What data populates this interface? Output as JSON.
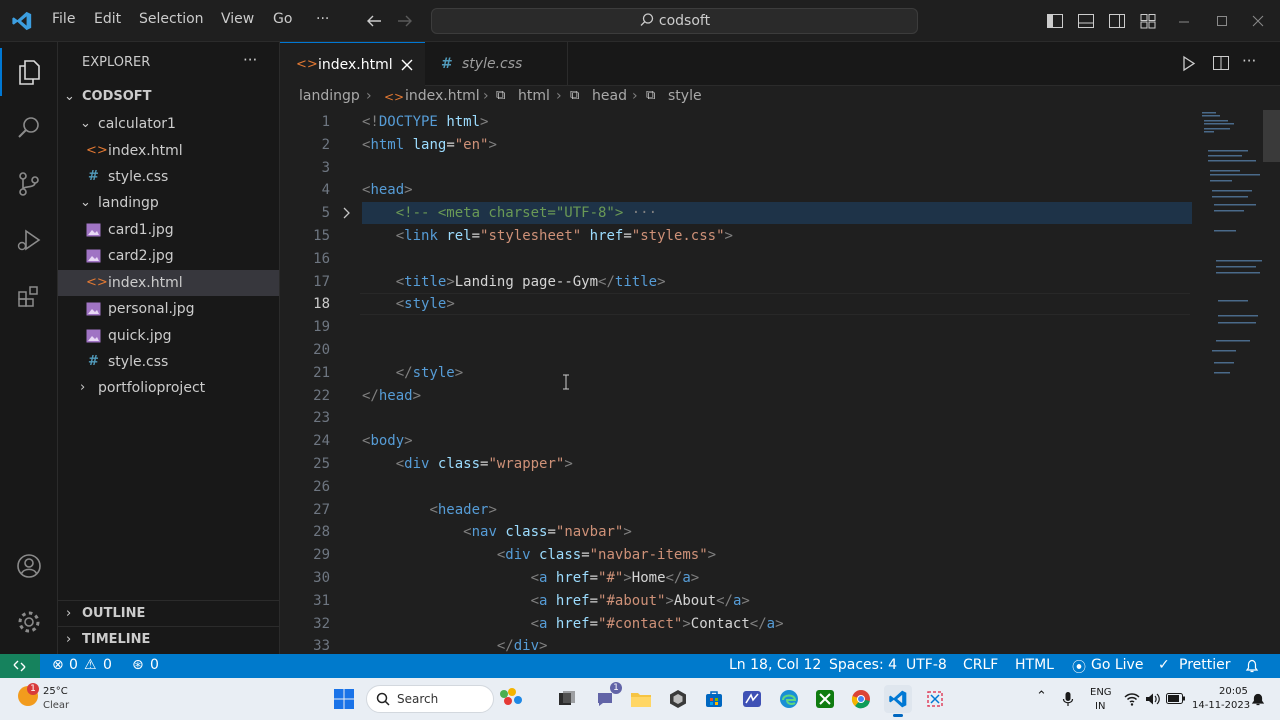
{
  "titlebar": {
    "menu": [
      "File",
      "Edit",
      "Selection",
      "View",
      "Go"
    ],
    "more": "···",
    "search": "codsoft"
  },
  "explorer": {
    "title": "EXPLORER",
    "more": "···",
    "root": "CODSOFT",
    "items": [
      {
        "label": "calculator1",
        "type": "folder",
        "open": true
      },
      {
        "label": "index.html",
        "type": "html"
      },
      {
        "label": "style.css",
        "type": "css"
      },
      {
        "label": "landingp",
        "type": "folder",
        "open": true
      },
      {
        "label": "card1.jpg",
        "type": "image"
      },
      {
        "label": "card2.jpg",
        "type": "image"
      },
      {
        "label": "index.html",
        "type": "html",
        "selected": true
      },
      {
        "label": "personal.jpg",
        "type": "image"
      },
      {
        "label": "quick.jpg",
        "type": "image"
      },
      {
        "label": "style.css",
        "type": "css"
      },
      {
        "label": "portfolioproject",
        "type": "folder",
        "open": false
      }
    ],
    "outline": "OUTLINE",
    "timeline": "TIMELINE"
  },
  "tabs": [
    {
      "label": "index.html",
      "active": true
    },
    {
      "label": "style.css",
      "active": false
    }
  ],
  "breadcrumb": [
    "landingp",
    "index.html",
    "html",
    "head",
    "style"
  ],
  "editor": {
    "current_line": 18,
    "lines": [
      {
        "n": "1",
        "code": [
          [
            "p",
            "<!"
          ],
          [
            "t",
            "DOCTYPE"
          ],
          [
            "x",
            " "
          ],
          [
            "a",
            "html"
          ],
          [
            "p",
            ">"
          ]
        ]
      },
      {
        "n": "2",
        "code": [
          [
            "p",
            "<"
          ],
          [
            "t",
            "html"
          ],
          [
            "x",
            " "
          ],
          [
            "a",
            "lang"
          ],
          [
            "x",
            "="
          ],
          [
            "s",
            "\"en\""
          ],
          [
            "p",
            ">"
          ]
        ]
      },
      {
        "n": "3",
        "code": []
      },
      {
        "n": "4",
        "code": [
          [
            "p",
            "<"
          ],
          [
            "t",
            "head"
          ],
          [
            "p",
            ">"
          ]
        ]
      },
      {
        "n": "5",
        "code": [
          [
            "x",
            "    "
          ],
          [
            "c",
            "<!-- <meta charset=\"UTF-8\">"
          ],
          [
            "p",
            " ···"
          ]
        ]
      },
      {
        "n": "15",
        "code": [
          [
            "x",
            "    "
          ],
          [
            "p",
            "<"
          ],
          [
            "t",
            "link"
          ],
          [
            "x",
            " "
          ],
          [
            "a",
            "rel"
          ],
          [
            "x",
            "="
          ],
          [
            "s",
            "\"stylesheet\""
          ],
          [
            "x",
            " "
          ],
          [
            "a",
            "href"
          ],
          [
            "x",
            "="
          ],
          [
            "s",
            "\"style.css\""
          ],
          [
            "p",
            ">"
          ]
        ]
      },
      {
        "n": "16",
        "code": []
      },
      {
        "n": "17",
        "code": [
          [
            "x",
            "    "
          ],
          [
            "p",
            "<"
          ],
          [
            "t",
            "title"
          ],
          [
            "p",
            ">"
          ],
          [
            "x",
            "Landing page--Gym"
          ],
          [
            "p",
            "</"
          ],
          [
            "t",
            "title"
          ],
          [
            "p",
            ">"
          ]
        ]
      },
      {
        "n": "18",
        "code": [
          [
            "x",
            "    "
          ],
          [
            "p",
            "<"
          ],
          [
            "t",
            "style"
          ],
          [
            "p",
            ">"
          ]
        ]
      },
      {
        "n": "19",
        "code": []
      },
      {
        "n": "20",
        "code": []
      },
      {
        "n": "21",
        "code": [
          [
            "x",
            "    "
          ],
          [
            "p",
            "</"
          ],
          [
            "t",
            "style"
          ],
          [
            "p",
            ">"
          ]
        ]
      },
      {
        "n": "22",
        "code": [
          [
            "p",
            "</"
          ],
          [
            "t",
            "head"
          ],
          [
            "p",
            ">"
          ]
        ]
      },
      {
        "n": "23",
        "code": []
      },
      {
        "n": "24",
        "code": [
          [
            "p",
            "<"
          ],
          [
            "t",
            "body"
          ],
          [
            "p",
            ">"
          ]
        ]
      },
      {
        "n": "25",
        "code": [
          [
            "x",
            "    "
          ],
          [
            "p",
            "<"
          ],
          [
            "t",
            "div"
          ],
          [
            "x",
            " "
          ],
          [
            "a",
            "class"
          ],
          [
            "x",
            "="
          ],
          [
            "s",
            "\"wrapper\""
          ],
          [
            "p",
            ">"
          ]
        ]
      },
      {
        "n": "26",
        "code": []
      },
      {
        "n": "27",
        "code": [
          [
            "x",
            "        "
          ],
          [
            "p",
            "<"
          ],
          [
            "t",
            "header"
          ],
          [
            "p",
            ">"
          ]
        ]
      },
      {
        "n": "28",
        "code": [
          [
            "x",
            "            "
          ],
          [
            "p",
            "<"
          ],
          [
            "t",
            "nav"
          ],
          [
            "x",
            " "
          ],
          [
            "a",
            "class"
          ],
          [
            "x",
            "="
          ],
          [
            "s",
            "\"navbar\""
          ],
          [
            "p",
            ">"
          ]
        ]
      },
      {
        "n": "29",
        "code": [
          [
            "x",
            "                "
          ],
          [
            "p",
            "<"
          ],
          [
            "t",
            "div"
          ],
          [
            "x",
            " "
          ],
          [
            "a",
            "class"
          ],
          [
            "x",
            "="
          ],
          [
            "s",
            "\"navbar-items\""
          ],
          [
            "p",
            ">"
          ]
        ]
      },
      {
        "n": "30",
        "code": [
          [
            "x",
            "                    "
          ],
          [
            "p",
            "<"
          ],
          [
            "t",
            "a"
          ],
          [
            "x",
            " "
          ],
          [
            "a",
            "href"
          ],
          [
            "x",
            "="
          ],
          [
            "s",
            "\"#\""
          ],
          [
            "p",
            ">"
          ],
          [
            "x",
            "Home"
          ],
          [
            "p",
            "</"
          ],
          [
            "t",
            "a"
          ],
          [
            "p",
            ">"
          ]
        ]
      },
      {
        "n": "31",
        "code": [
          [
            "x",
            "                    "
          ],
          [
            "p",
            "<"
          ],
          [
            "t",
            "a"
          ],
          [
            "x",
            " "
          ],
          [
            "a",
            "href"
          ],
          [
            "x",
            "="
          ],
          [
            "s",
            "\"#about\""
          ],
          [
            "p",
            ">"
          ],
          [
            "x",
            "About"
          ],
          [
            "p",
            "</"
          ],
          [
            "t",
            "a"
          ],
          [
            "p",
            ">"
          ]
        ]
      },
      {
        "n": "32",
        "code": [
          [
            "x",
            "                    "
          ],
          [
            "p",
            "<"
          ],
          [
            "t",
            "a"
          ],
          [
            "x",
            " "
          ],
          [
            "a",
            "href"
          ],
          [
            "x",
            "="
          ],
          [
            "s",
            "\"#contact\""
          ],
          [
            "p",
            ">"
          ],
          [
            "x",
            "Contact"
          ],
          [
            "p",
            "</"
          ],
          [
            "t",
            "a"
          ],
          [
            "p",
            ">"
          ]
        ]
      },
      {
        "n": "33",
        "code": [
          [
            "x",
            "                "
          ],
          [
            "p",
            "</"
          ],
          [
            "t",
            "div"
          ],
          [
            "p",
            ">"
          ]
        ]
      }
    ]
  },
  "statusbar": {
    "errors": "0",
    "warnings": "0",
    "ports": "0",
    "position": "Ln 18, Col 12",
    "spaces": "Spaces: 4",
    "encoding": "UTF-8",
    "eol": "CRLF",
    "language": "HTML",
    "golive": "Go Live",
    "prettier": "Prettier"
  },
  "taskbar": {
    "weather_temp": "25°C",
    "weather_desc": "Clear",
    "weather_badge": "1",
    "search": "Search",
    "chat_badge": "1",
    "lang1": "ENG",
    "lang2": "IN",
    "time": "20:05",
    "date": "14-11-2023"
  },
  "colors": {
    "accent": "#007acc",
    "tag": "#569cd6",
    "attribute": "#9cdcfe",
    "string": "#ce9178",
    "comment": "#6a9955"
  }
}
